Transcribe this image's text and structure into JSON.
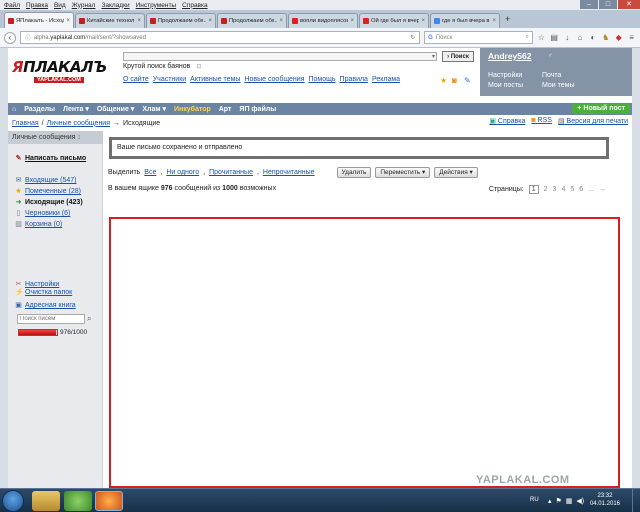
{
  "menubar": [
    "Файл",
    "Правка",
    "Вид",
    "Журнал",
    "Закладки",
    "Инструменты",
    "Справка"
  ],
  "tabs": [
    {
      "label": "ЯПлакалъ - Исход...",
      "active": true,
      "color": "#c81e1e"
    },
    {
      "label": "Китайские технол...",
      "active": false,
      "color": "#c81e1e"
    },
    {
      "label": "Продолжаем обх...",
      "active": false,
      "color": "#c81e1e"
    },
    {
      "label": "Продолжаем обх...",
      "active": false,
      "color": "#c81e1e"
    },
    {
      "label": "вопли видоплясов...",
      "active": false,
      "color": "#e02020"
    },
    {
      "label": "Ой где был я вчер...",
      "active": false,
      "color": "#e02020"
    },
    {
      "label": "где я был вчера в...",
      "active": false,
      "color": "#4285f4"
    }
  ],
  "url": {
    "prefix": "alpha.",
    "domain": "yaplakal.com",
    "path": "/mail/sent/?showsaved"
  },
  "browser_search_placeholder": "Поиск",
  "site": {
    "logo_main_a": "Я",
    "logo_main_b": "ПЛАКАЛЪ",
    "logo_sub": "YAPLAKAL.COM",
    "search_button": "Поиск",
    "promo": "Крутой поиск баянов",
    "toplinks": [
      "О сайте",
      "Участники",
      "Активные темы",
      "Новые сообщения",
      "Помощь",
      "Правила",
      "Реклама"
    ],
    "user": {
      "name": "Andrey562",
      "settings": "Настройки",
      "mail": "Почта",
      "my_posts": "Мои посты",
      "my_topics": "Мои темы"
    },
    "nav": [
      "Разделы",
      "Лента",
      "Общение",
      "Хлам",
      "Инкубатор",
      "Арт",
      "ЯП файлы"
    ],
    "new_post": "Новый пост"
  },
  "breadcrumb": {
    "home": "Главная",
    "sep": "/",
    "section": "Личные сообщения",
    "arrow": "→",
    "current": "Исходящие"
  },
  "right_links": [
    "Справка",
    "RSS",
    "Версия для печати"
  ],
  "sidebar": {
    "header": "Личные сообщения",
    "write": "Написать письмо",
    "folders": [
      {
        "label": "Входящие (547)",
        "icon": "inbox-icon"
      },
      {
        "label": "Помеченные (28)",
        "icon": "star-icon"
      },
      {
        "label": "Исходящие (423)",
        "icon": "outbox-icon"
      },
      {
        "label": "Черновики (6)",
        "icon": "draft-icon"
      },
      {
        "label": "Корзина (0)",
        "icon": "trash-icon"
      }
    ],
    "settings": "Настройки",
    "clean": "Очистка папок",
    "addressbook": "Адресная книга",
    "search_placeholder": "Поиск писем",
    "quota_text": "976/1000",
    "quota_fraction": 0.976
  },
  "main": {
    "alert": "Ваше письмо сохранено и отправлено",
    "select_label": "Выделить",
    "select_all": "Все",
    "select_none": "Ни одного",
    "select_read": "Прочитанные",
    "select_unread": "Непрочитанные",
    "delete_btn": "Удалить",
    "move_btn": "Переместить",
    "actions_btn": "Действия",
    "summary_a": "В вашем ящике",
    "count": "976",
    "summary_b": "сообщений из",
    "total": "1000",
    "summary_c": "возможных",
    "pages_label": "Страницы:",
    "pages": [
      "1",
      "2",
      "3",
      "4",
      "5",
      "6",
      "...",
      "→"
    ]
  },
  "watermark": "YAPLAKAL.COM",
  "taskbar": {
    "lang": "RU",
    "time": "23:32",
    "date": "04.01.2016"
  }
}
